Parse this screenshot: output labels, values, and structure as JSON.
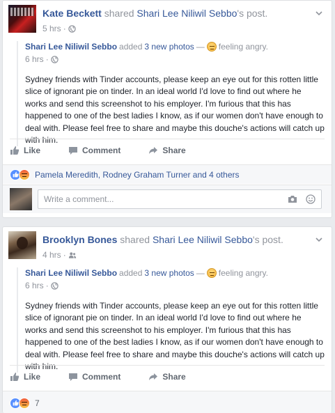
{
  "post1": {
    "author": "Kate Beckett",
    "action": " shared ",
    "shared_author": "Shari Lee Niliwil Sebbo",
    "shared_suffix": "'s post.",
    "time": "5 hrs",
    "privacy_icon": "globe-icon",
    "inner": {
      "author": "Shari Lee Niliwil Sebbo",
      "action": " added ",
      "photos_link": "3 new photos",
      "dash": " — ",
      "feeling": "feeling angry.",
      "time": "6 hrs",
      "body": "Sydney friends with Tinder accounts, please keep an eye out for this rotten little slice of ignorant pie on tinder. In an ideal world I'd love to find out where he works and send this screenshot to his employer. I'm furious that this has happened to one of the best ladies I know, as if our women don't have enough to deal with. Please feel free to share and maybe this douche's actions will catch up with him."
    },
    "actions": {
      "like": "Like",
      "comment": "Comment",
      "share": "Share"
    },
    "reactions_text": "Pamela Meredith, Rodney Graham Turner and 4 others",
    "comment_placeholder": "Write a comment..."
  },
  "post2": {
    "author": "Brooklyn Bones",
    "action": " shared ",
    "shared_author": "Shari Lee Niliwil Sebbo",
    "shared_suffix": "'s post.",
    "time": "4 hrs",
    "privacy_icon": "friends-icon",
    "inner": {
      "author": "Shari Lee Niliwil Sebbo",
      "action": " added ",
      "photos_link": "3 new photos",
      "dash": " — ",
      "feeling": "feeling angry.",
      "time": "6 hrs",
      "body": "Sydney friends with Tinder accounts, please keep an eye out for this rotten little slice of ignorant pie on tinder. In an ideal world I'd love to find out where he works and send this screenshot to his employer. I'm furious that this has happened to one of the best ladies I know, as if our women don't have enough to deal with. Please feel free to share and maybe this douche's actions will catch up with him."
    },
    "actions": {
      "like": "Like",
      "comment": "Comment",
      "share": "Share"
    },
    "reactions_count": "7"
  },
  "separator": "·",
  "colors": {
    "link": "#365899",
    "muted": "#90949c",
    "like_blue": "#5890ff"
  }
}
